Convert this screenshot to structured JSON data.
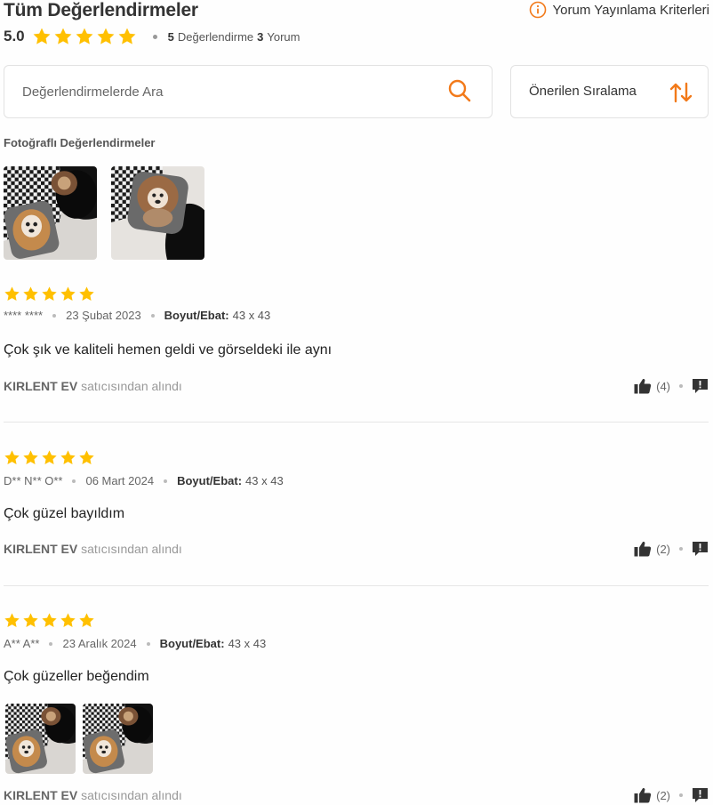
{
  "header": {
    "title": "Tüm Değerlendirmeler",
    "criteria_link": "Yorum Yayınlama Kriterleri",
    "score": "5.0",
    "rating_count": "5",
    "rating_label": "Değerlendirme",
    "comment_count": "3",
    "comment_label": "Yorum"
  },
  "search": {
    "placeholder": "Değerlendirmelerde Ara",
    "value": ""
  },
  "sort": {
    "label": "Önerilen Sıralama"
  },
  "photos_section": {
    "title": "Fotoğraflı Değerlendirmeler"
  },
  "reviews": [
    {
      "rating": 5,
      "author": "**** ****",
      "date": "23 Şubat 2023",
      "size_label": "Boyut/Ebat:",
      "size_value": "43 x 43",
      "comment": "Çok şık ve kaliteli hemen geldi ve görseldeki ile aynı",
      "seller": "KIRLENT EV",
      "seller_suffix": "satıcısından alındı",
      "likes": "(4)"
    },
    {
      "rating": 5,
      "author": "D** N** O**",
      "date": "06 Mart 2024",
      "size_label": "Boyut/Ebat:",
      "size_value": "43 x 43",
      "comment": "Çok güzel bayıldım",
      "seller": "KIRLENT EV",
      "seller_suffix": "satıcısından alındı",
      "likes": "(2)"
    },
    {
      "rating": 5,
      "author": "A** A**",
      "date": "23 Aralık 2024",
      "size_label": "Boyut/Ebat:",
      "size_value": "43 x 43",
      "comment": "Çok güzeller beğendim",
      "seller": "KIRLENT EV",
      "seller_suffix": "satıcısından alındı",
      "likes": "(2)"
    }
  ],
  "colors": {
    "accent": "#f27a1a",
    "star": "#ffc000",
    "text": "#333333",
    "muted": "#999999"
  },
  "icons": {
    "info": "info-icon",
    "search": "search-icon",
    "sort": "sort-arrows-icon",
    "like": "thumbs-up-icon",
    "report": "report-icon",
    "star": "star-icon"
  }
}
